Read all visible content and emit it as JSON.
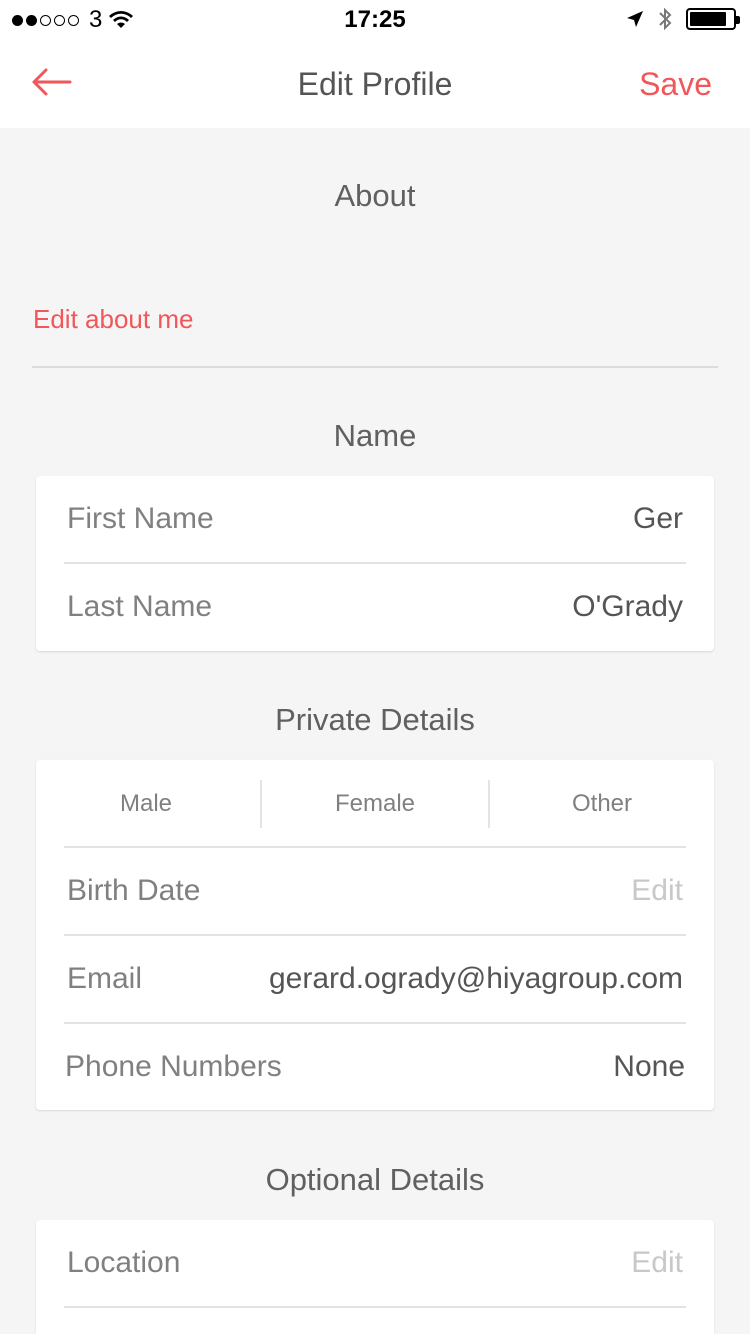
{
  "status_bar": {
    "signal_dots": [
      true,
      true,
      false,
      false,
      false
    ],
    "carrier": "3",
    "time": "17:25",
    "battery_level": 0.85,
    "icons": [
      "wifi-icon",
      "location-arrow-icon",
      "bluetooth-icon",
      "battery-icon"
    ]
  },
  "nav": {
    "back_icon": "back-arrow-icon",
    "title": "Edit Profile",
    "save_label": "Save"
  },
  "about": {
    "title": "About",
    "edit_label": "Edit about me"
  },
  "name_section": {
    "title": "Name",
    "rows": [
      {
        "label": "First Name",
        "value": "Ger"
      },
      {
        "label": "Last Name",
        "value": "O'Grady"
      }
    ]
  },
  "private_details": {
    "title": "Private Details",
    "gender_options": [
      "Male",
      "Female",
      "Other"
    ],
    "rows": [
      {
        "label": "Birth Date",
        "value": "Edit"
      },
      {
        "label": "Email",
        "value": "gerard.ogrady@hiyagroup.com"
      },
      {
        "label": "Phone Numbers",
        "value": "None"
      }
    ]
  },
  "optional_details": {
    "title": "Optional Details",
    "rows": [
      {
        "label": "Location",
        "value": "Edit"
      }
    ]
  },
  "colors": {
    "accent": "#f0575a",
    "background": "#f5f5f5",
    "card": "#ffffff",
    "label": "#808080",
    "value": "#555555",
    "placeholder": "#c8c8c8"
  }
}
